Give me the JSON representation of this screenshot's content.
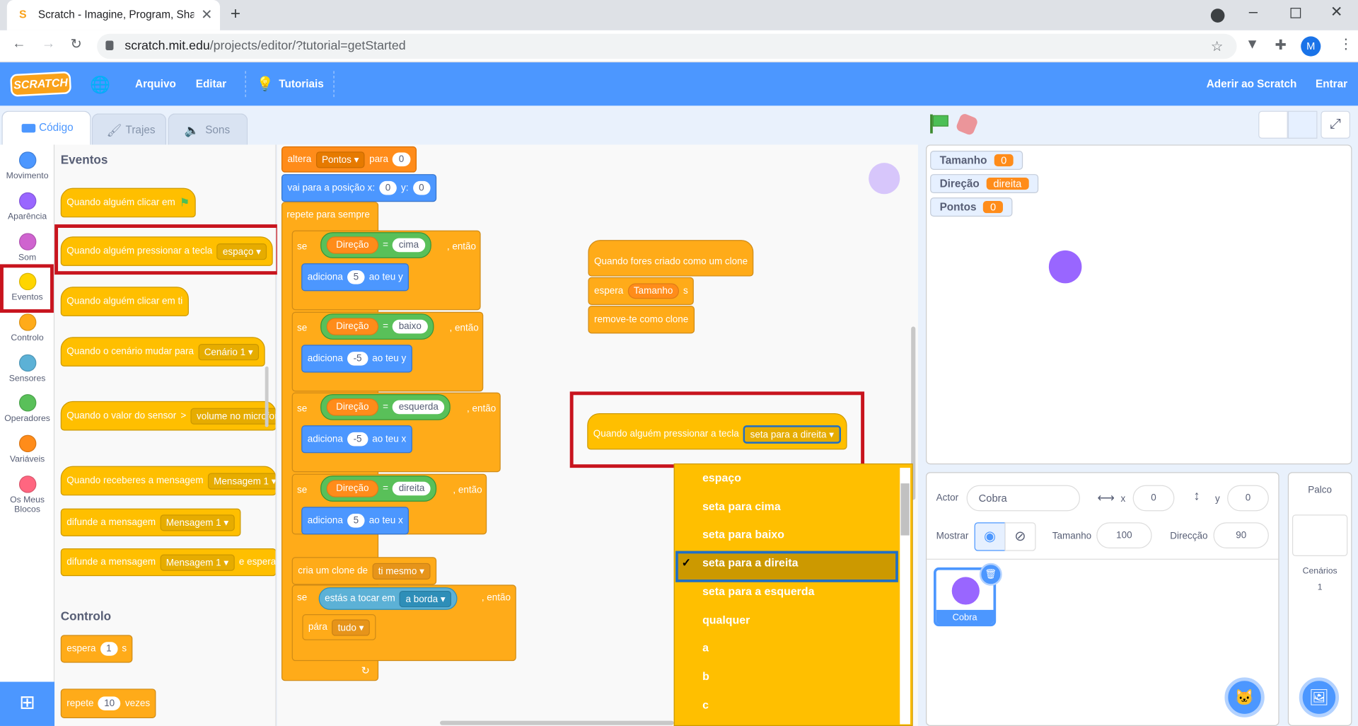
{
  "browser": {
    "tab_title": "Scratch - Imagine, Program, Shar",
    "url_host": "scratch.mit.edu",
    "url_path": "/projects/editor/?tutorial=getStarted",
    "profile_initial": "M"
  },
  "menu": {
    "logo": "SCRATCH",
    "file": "Arquivo",
    "edit": "Editar",
    "tutorials": "Tutoriais",
    "join": "Aderir ao Scratch",
    "signin": "Entrar"
  },
  "tabs": {
    "code": "Código",
    "costumes": "Trajes",
    "sounds": "Sons"
  },
  "categories": [
    {
      "label": "Movimento",
      "color": "#4c97ff"
    },
    {
      "label": "Aparência",
      "color": "#9966ff"
    },
    {
      "label": "Som",
      "color": "#cf63cf"
    },
    {
      "label": "Eventos",
      "color": "#ffd500"
    },
    {
      "label": "Controlo",
      "color": "#ffab19"
    },
    {
      "label": "Sensores",
      "color": "#5cb1d6"
    },
    {
      "label": "Operadores",
      "color": "#59c059"
    },
    {
      "label": "Variáveis",
      "color": "#ff8c1a"
    },
    {
      "label": "Os Meus Blocos",
      "color": "#ff6680"
    }
  ],
  "palette": {
    "events_heading": "Eventos",
    "when_flag": "Quando alguém clicar em",
    "when_key": "Quando alguém pressionar a tecla",
    "when_key_value": "espaço",
    "when_sprite": "Quando alguém clicar em ti",
    "when_backdrop": "Quando o cenário mudar para",
    "when_backdrop_value": "Cenário 1",
    "when_sensor": "Quando o valor do sensor",
    "when_sensor_value": "volume no microfone",
    "when_message": "Quando receberes a mensagem",
    "message_value": "Mensagem 1",
    "broadcast": "difunde a mensagem",
    "broadcast_wait": "difunde a mensagem",
    "broadcast_wait_suffix": "e espera",
    "control_heading": "Controlo",
    "wait": "espera",
    "wait_value": "1",
    "wait_unit": "s",
    "repeat": "repete",
    "repeat_value": "10",
    "repeat_unit": "vezes"
  },
  "script1": {
    "set_var": "altera",
    "set_var_name": "Pontos",
    "set_to": "para",
    "set_value": "0",
    "goto": "vai para a posição x:",
    "goto_x": "0",
    "goto_y_label": "y:",
    "goto_y": "0",
    "forever": "repete para sempre",
    "if": "se",
    "then": ", então",
    "eq": "=",
    "var_dir": "Direção",
    "if1_value": "cima",
    "if2_value": "baixo",
    "if3_value": "esquerda",
    "if4_value": "direita",
    "add": "adiciona",
    "to_y": "ao teu y",
    "to_x": "ao teu x",
    "add1": "5",
    "add2": "-5",
    "add3": "-5",
    "add4": "5",
    "clone": "cria um clone de",
    "clone_target": "ti mesmo",
    "touching": "estás a tocar em",
    "touching_target": "a borda",
    "stop": "pára",
    "stop_target": "tudo"
  },
  "script2": {
    "hat": "Quando fores criado como um clone",
    "wait": "espera",
    "wait_var": "Tamanho",
    "wait_unit": "s",
    "delete": "remove-te como clone"
  },
  "script3": {
    "hat": "Quando alguém pressionar a tecla",
    "key": "seta para a direita"
  },
  "dropdown": {
    "options": [
      "espaço",
      "seta para cima",
      "seta para baixo",
      "seta para a direita",
      "seta para a esquerda",
      "qualquer",
      "a",
      "b",
      "c"
    ],
    "selected": "seta para a direita",
    "check": "✓"
  },
  "monitors": [
    {
      "name": "Tamanho",
      "value": "0"
    },
    {
      "name": "Direção",
      "value": "direita"
    },
    {
      "name": "Pontos",
      "value": "0"
    }
  ],
  "sprite_info": {
    "actor_label": "Actor",
    "actor_name": "Cobra",
    "x_label": "x",
    "x": "0",
    "y_label": "y",
    "y": "0",
    "show_label": "Mostrar",
    "size_label": "Tamanho",
    "size": "100",
    "dir_label": "Direcção",
    "dir": "90"
  },
  "sprites": [
    {
      "name": "Cobra"
    }
  ],
  "stage_pane": {
    "title": "Palco",
    "backdrops_label": "Cenários",
    "backdrops_count": "1"
  },
  "colors": {
    "menu_blue": "#4c97ff",
    "sprite_purple": "#9966ff"
  }
}
